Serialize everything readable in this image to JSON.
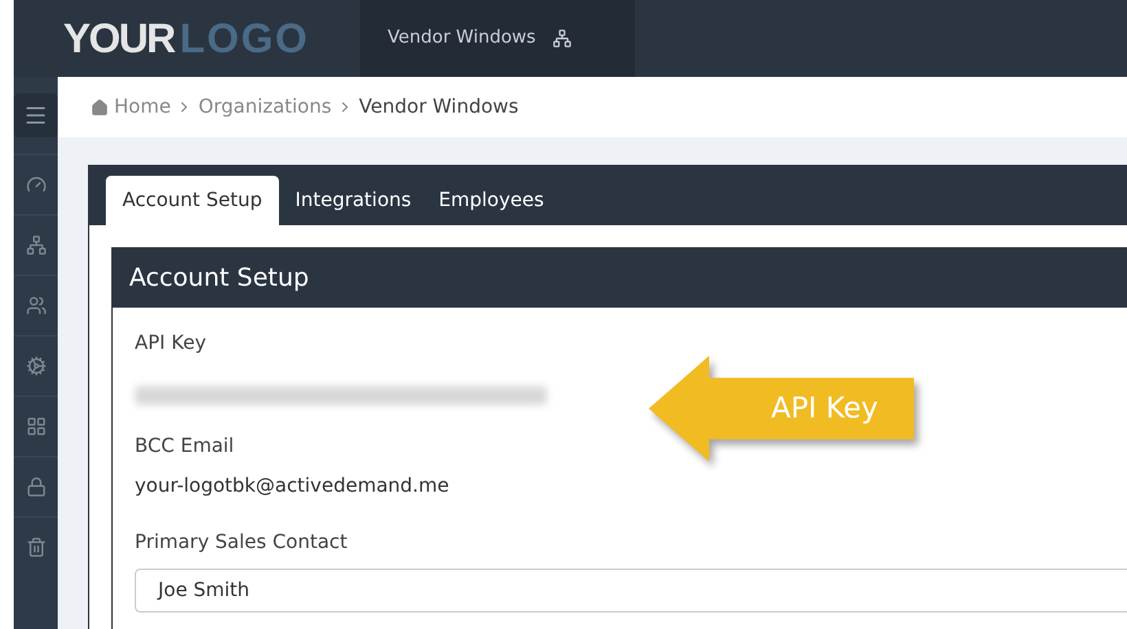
{
  "logo": {
    "word1": "YOUR",
    "word2": "LOGO"
  },
  "topbar": {
    "org_name": "Vendor Windows"
  },
  "breadcrumb": [
    {
      "label": "Home",
      "current": false
    },
    {
      "label": "Organizations",
      "current": false
    },
    {
      "label": "Vendor Windows",
      "current": true
    }
  ],
  "tabs": [
    {
      "label": "Account Setup",
      "selected": true
    },
    {
      "label": "Integrations",
      "selected": false
    },
    {
      "label": "Employees",
      "selected": false
    }
  ],
  "panel": {
    "title": "Account Setup",
    "fields": [
      {
        "kind": "redacted",
        "label": "API Key"
      },
      {
        "kind": "text",
        "label": "BCC Email",
        "value": "your-logotbk@activedemand.me"
      },
      {
        "kind": "input",
        "label": "Primary Sales Contact",
        "value": "Joe Smith"
      }
    ]
  },
  "callout": {
    "text": "API Key"
  }
}
